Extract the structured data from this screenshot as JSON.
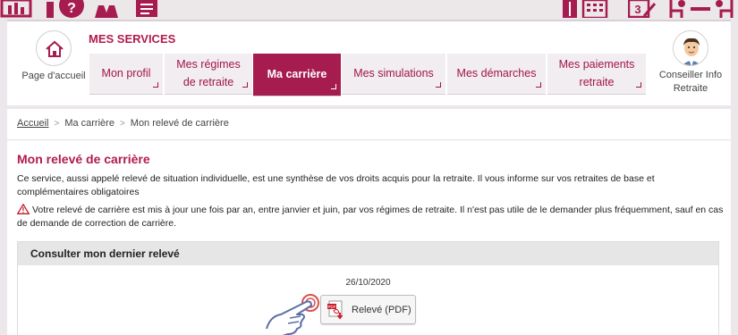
{
  "colors": {
    "brand": "#a61c4f",
    "brand_text": "#b01b4f",
    "panel_header": "#e6e6e6"
  },
  "header": {
    "home_label": "Page d'accueil",
    "services_title": "MES SERVICES",
    "tabs": [
      {
        "label_line1": "Mon profil",
        "label_line2": ""
      },
      {
        "label_line1": "Mes régimes",
        "label_line2": "de retraite"
      },
      {
        "label_line1": "Ma carrière",
        "label_line2": ""
      },
      {
        "label_line1": "Mes simulations",
        "label_line2": ""
      },
      {
        "label_line1": "Mes démarches",
        "label_line2": ""
      },
      {
        "label_line1": "Mes paiements",
        "label_line2": "retraite"
      }
    ],
    "active_tab": "Ma carrière",
    "advisor_line1": "Conseiller Info",
    "advisor_line2": "Retraite"
  },
  "breadcrumb": {
    "home": "Accueil",
    "section": "Ma carrière",
    "current": "Mon relevé de carrière"
  },
  "page": {
    "title": "Mon relevé de carrière",
    "intro": "Ce service, aussi appelé relevé de situation individuelle, est une synthèse de vos droits acquis pour la retraite. Il vous informe sur vos retraites de base et complémentaires obligatoires",
    "warning": "Votre relevé de carrière est mis à  jour une fois par an, entre janvier et juin, par vos régimes de retraite. Il n'est pas utile de le demander plus fréquemment, sauf en cas de demande de correction de carrière."
  },
  "panel": {
    "title": "Consulter mon dernier relevé",
    "date": "26/10/2020",
    "button_label": "Relevé (PDF)"
  },
  "icons": [
    "chart-icon",
    "help-icon",
    "people-icon",
    "document-icon",
    "agent-icon",
    "calendar-icon",
    "form-icon",
    "meeting-icon",
    "home-icon",
    "advisor-avatar",
    "warning-icon",
    "pdf-icon",
    "hand-cursor-icon"
  ]
}
